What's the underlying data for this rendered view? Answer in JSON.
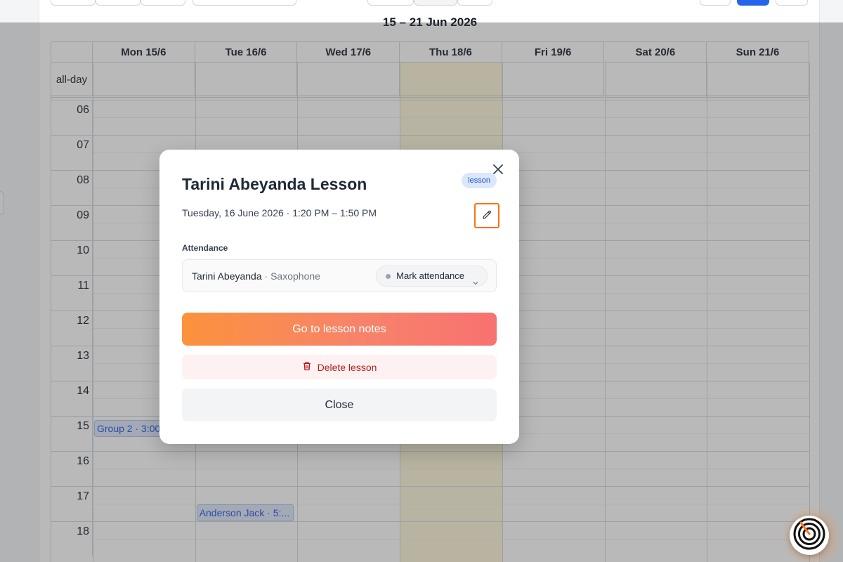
{
  "calendar": {
    "week_title": "15 – 21 Jun 2026",
    "all_day_label": "all-day",
    "days": [
      "Mon 15/6",
      "Tue 16/6",
      "Wed 17/6",
      "Thu 18/6",
      "Fri 19/6",
      "Sat 20/6",
      "Sun 21/6"
    ],
    "today_index": 3,
    "hours": [
      "06",
      "07",
      "08",
      "09",
      "10",
      "11",
      "12",
      "13",
      "14",
      "15",
      "16",
      "17",
      "18"
    ],
    "events": [
      {
        "label": "Group 2 · 3:00",
        "day_index": 0
      },
      {
        "label": "Anderson Jack · 5:...",
        "day_index": 1
      }
    ]
  },
  "modal": {
    "title": "Tarini Abeyanda Lesson",
    "badge": "lesson",
    "datetime": "Tuesday, 16 June 2026 · 1:20 PM – 1:50 PM",
    "attendance_label": "Attendance",
    "student_name": "Tarini Abeyanda",
    "student_instrument": " · Saxophone",
    "mark_attendance": "Mark attendance",
    "notes_button": "Go to lesson notes",
    "delete_button": "Delete lesson",
    "close_button": "Close"
  },
  "colors": {
    "accent_orange": "#f97316",
    "badge_blue": "#1d4ed8",
    "delete_red": "#b91c1c",
    "today_highlight": "#fdf7d9"
  },
  "icons": {
    "close": "close-icon",
    "edit": "pencil-icon",
    "delete": "trash-icon",
    "dropdown": "chevron-down-icon",
    "assistant": "assistant-logo-icon"
  }
}
